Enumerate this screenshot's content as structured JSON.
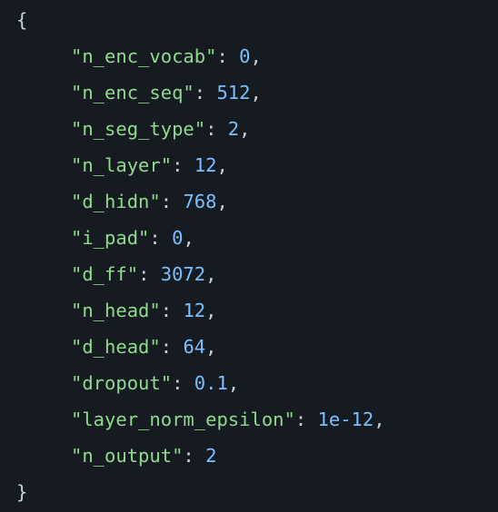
{
  "code": {
    "open_brace": "{",
    "close_brace": "}",
    "entries": [
      {
        "key": "\"n_enc_vocab\"",
        "value": "0",
        "comma": ","
      },
      {
        "key": "\"n_enc_seq\"",
        "value": "512",
        "comma": ","
      },
      {
        "key": "\"n_seg_type\"",
        "value": "2",
        "comma": ","
      },
      {
        "key": "\"n_layer\"",
        "value": "12",
        "comma": ","
      },
      {
        "key": "\"d_hidn\"",
        "value": "768",
        "comma": ","
      },
      {
        "key": "\"i_pad\"",
        "value": "0",
        "comma": ","
      },
      {
        "key": "\"d_ff\"",
        "value": "3072",
        "comma": ","
      },
      {
        "key": "\"n_head\"",
        "value": "12",
        "comma": ","
      },
      {
        "key": "\"d_head\"",
        "value": "64",
        "comma": ","
      },
      {
        "key": "\"dropout\"",
        "value": "0.1",
        "comma": ","
      },
      {
        "key": "\"layer_norm_epsilon\"",
        "value": "1e-12",
        "comma": ","
      },
      {
        "key": "\"n_output\"",
        "value": "2",
        "comma": ""
      }
    ],
    "colon": ": "
  },
  "colors": {
    "background": "#161b22",
    "key": "#8ddb8c",
    "number": "#79c0ff",
    "text": "#c9d1d9"
  }
}
